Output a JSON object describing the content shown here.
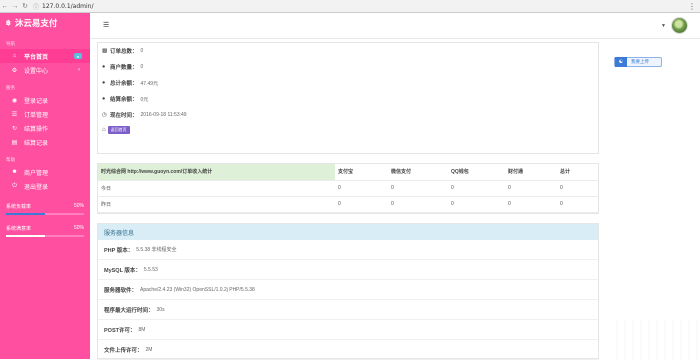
{
  "browser": {
    "url": "127.0.0.1/admin/"
  },
  "sidebar": {
    "brand": "沐云易支付",
    "brand_icon": "bitcoin-icon",
    "nav_title": "导航",
    "items": [
      {
        "label": "平台首页",
        "icon": "home-icon",
        "badge": "●"
      },
      {
        "label": "设置中心",
        "icon": "gear-icon"
      }
    ],
    "service_title": "服务",
    "service_items": [
      {
        "label": "登录记录",
        "icon": "camera-icon"
      },
      {
        "label": "订单管理",
        "icon": "cart-icon"
      },
      {
        "label": "结算操作",
        "icon": "refresh-icon"
      },
      {
        "label": "结算记录",
        "icon": "chart-icon"
      }
    ],
    "help_title": "帮助",
    "help_items": [
      {
        "label": "商户管理",
        "icon": "user-icon"
      },
      {
        "label": "退出登录",
        "icon": "power-icon"
      }
    ],
    "meters": [
      {
        "label": "系统负载率",
        "value": "50%",
        "fraction": 0.5,
        "color": "#3c7ad8"
      },
      {
        "label": "系统满意率",
        "value": "50%",
        "fraction": 0.5,
        "color": "#ffffff"
      }
    ]
  },
  "topbar": {
    "avatar": "avatar"
  },
  "stats": [
    {
      "label": "订单总数：",
      "value": "0"
    },
    {
      "label": "商户数量：",
      "value": "0"
    },
    {
      "label": "总计余额：",
      "value": "47.49元"
    },
    {
      "label": "结算余额：",
      "value": "0元"
    },
    {
      "label": "现在时间：",
      "value": "2016-09-18 11:53:49"
    }
  ],
  "back_button": "返回首页",
  "upload_button": "我要上传",
  "income_table": {
    "headers": [
      "时光综合网 http://www.guoyn.com/订单收入统计",
      "支付宝",
      "微信支付",
      "QQ钱包",
      "财付通",
      "总计"
    ],
    "rows": [
      [
        "今日",
        "0",
        "0",
        "0",
        "0",
        "0"
      ],
      [
        "昨日",
        "0",
        "0",
        "0",
        "0",
        "0"
      ]
    ]
  },
  "server": {
    "title": "服务器信息",
    "rows": [
      {
        "label": "PHP 版本：",
        "value": "5.5.38 非线程安全"
      },
      {
        "label": "MySQL 版本：",
        "value": "5.5.53"
      },
      {
        "label": "服务器软件：",
        "value": "Apache/2.4.23 (Win32) OpenSSL/1.0.2j PHP/5.5.38"
      },
      {
        "label": "程序最大运行时间：",
        "value": "30s"
      },
      {
        "label": "POST许可：",
        "value": "8M"
      },
      {
        "label": "文件上传许可：",
        "value": "2M"
      }
    ]
  }
}
